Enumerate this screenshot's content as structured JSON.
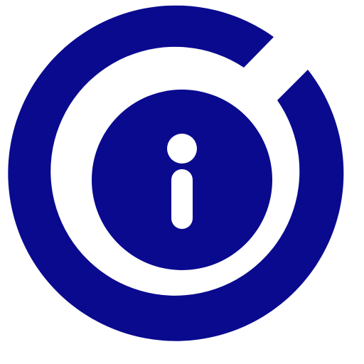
{
  "icon": {
    "name": "info-icon",
    "color": "#0a0a8f",
    "background": "#ffffff"
  }
}
